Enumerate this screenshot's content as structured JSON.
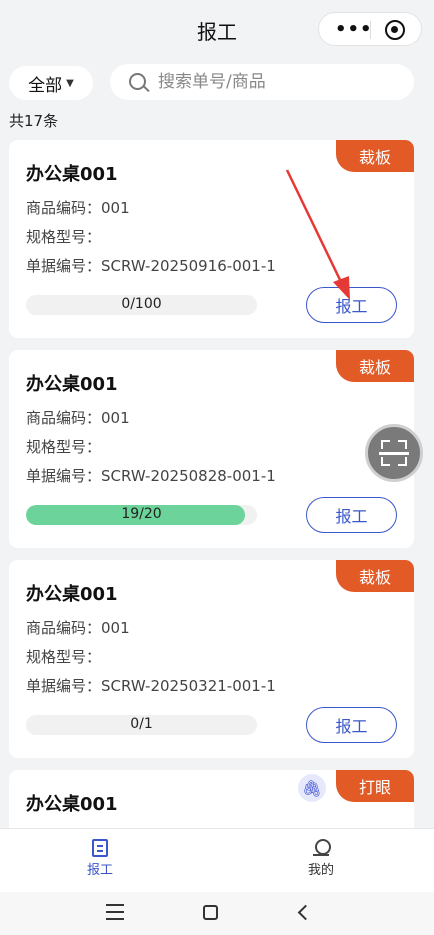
{
  "header": {
    "title": "报工"
  },
  "filter": {
    "label": "全部"
  },
  "search": {
    "placeholder": "搜索单号/商品"
  },
  "summary": {
    "count_text": "共17条"
  },
  "labels": {
    "product_code": "商品编码：",
    "spec": "规格型号：",
    "doc_no": "单据编号："
  },
  "cards": [
    {
      "title": "办公桌001",
      "tag": "裁板",
      "product_code": "001",
      "spec": "",
      "doc_no": "SCRW-20250916-001-1",
      "progress_text": "0/100",
      "progress": 0,
      "button": "报工"
    },
    {
      "title": "办公桌001",
      "tag": "裁板",
      "product_code": "001",
      "spec": "",
      "doc_no": "SCRW-20250828-001-1",
      "progress_text": "19/20",
      "progress": 0.95,
      "button": "报工"
    },
    {
      "title": "办公桌001",
      "tag": "裁板",
      "product_code": "001",
      "spec": "",
      "doc_no": "SCRW-20250321-001-1",
      "progress_text": "0/1",
      "progress": 0,
      "button": "报工"
    },
    {
      "title": "办公桌001",
      "tag": "打眼"
    }
  ],
  "tabbar": {
    "report": "报工",
    "mine": "我的"
  },
  "icons": {
    "menu": "more-dots-icon",
    "close": "target-icon",
    "scan": "scan-icon",
    "attach": "paperclip-icon"
  },
  "colors": {
    "accent": "#3b57c9",
    "tag": "#e25a26",
    "progress": "#6cd39a"
  }
}
